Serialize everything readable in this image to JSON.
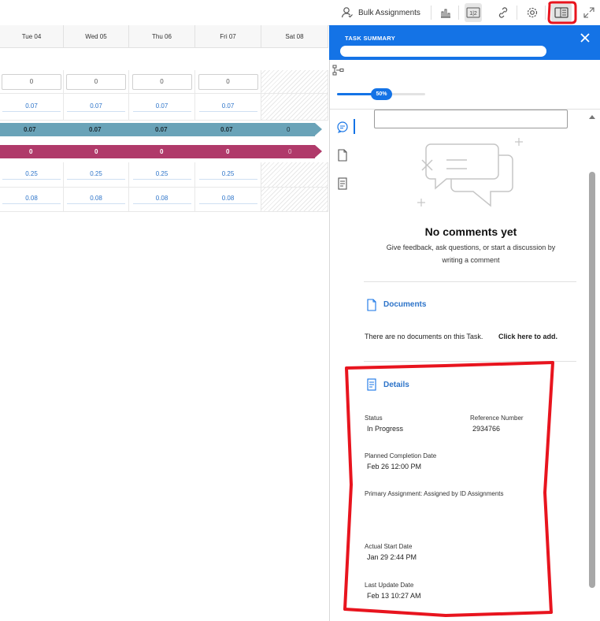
{
  "toolbar": {
    "bulk_label": "Bulk Assignments",
    "icons": [
      "user-icon",
      "bar-chart-icon",
      "numbers-icon",
      "link-icon",
      "gear-icon",
      "panel-toggle-icon",
      "expand-icon"
    ]
  },
  "grid": {
    "headers": [
      "Tue 04",
      "Wed 05",
      "Thu 06",
      "Fri 07",
      "Sat 08"
    ],
    "row1": [
      "0",
      "0",
      "0",
      "0"
    ],
    "row2": [
      "0.07",
      "0.07",
      "0.07",
      "0.07"
    ],
    "row3": [
      "0.07",
      "0.07",
      "0.07",
      "0.07",
      "0"
    ],
    "row4": [
      "0",
      "0",
      "0",
      "0",
      "0"
    ],
    "row5": [
      "0.25",
      "0.25",
      "0.25",
      "0.25"
    ],
    "row6": [
      "0.08",
      "0.08",
      "0.08",
      "0.08"
    ]
  },
  "panel": {
    "header_label": "TASK SUMMARY",
    "progress": 50,
    "progress_label": "50%",
    "comments": {
      "title": "No comments yet",
      "subtitle_1": "Give feedback, ask questions, or start a discussion by",
      "subtitle_2": "writing a comment"
    },
    "documents": {
      "title": "Documents",
      "empty": "There are no documents on this Task.",
      "add_link": "Click here to add."
    },
    "details": {
      "title": "Details",
      "status_label": "Status",
      "status_value": "In Progress",
      "ref_label": "Reference Number",
      "ref_value": "2934766",
      "planned_label": "Planned Completion Date",
      "planned_value": "Feb 26 12:00 PM",
      "primary_label": "Primary Assignment: Assigned by ID Assignments",
      "actual_label": "Actual Start Date",
      "actual_value": "Jan 29 2:44 PM",
      "update_label": "Last Update Date",
      "update_value": "Feb 13 10:27 AM"
    }
  },
  "colors": {
    "accent": "#1473e6",
    "teal_bar": "#6aa3b8",
    "magenta_bar": "#b03a6a",
    "annotation": "#e8141e"
  }
}
